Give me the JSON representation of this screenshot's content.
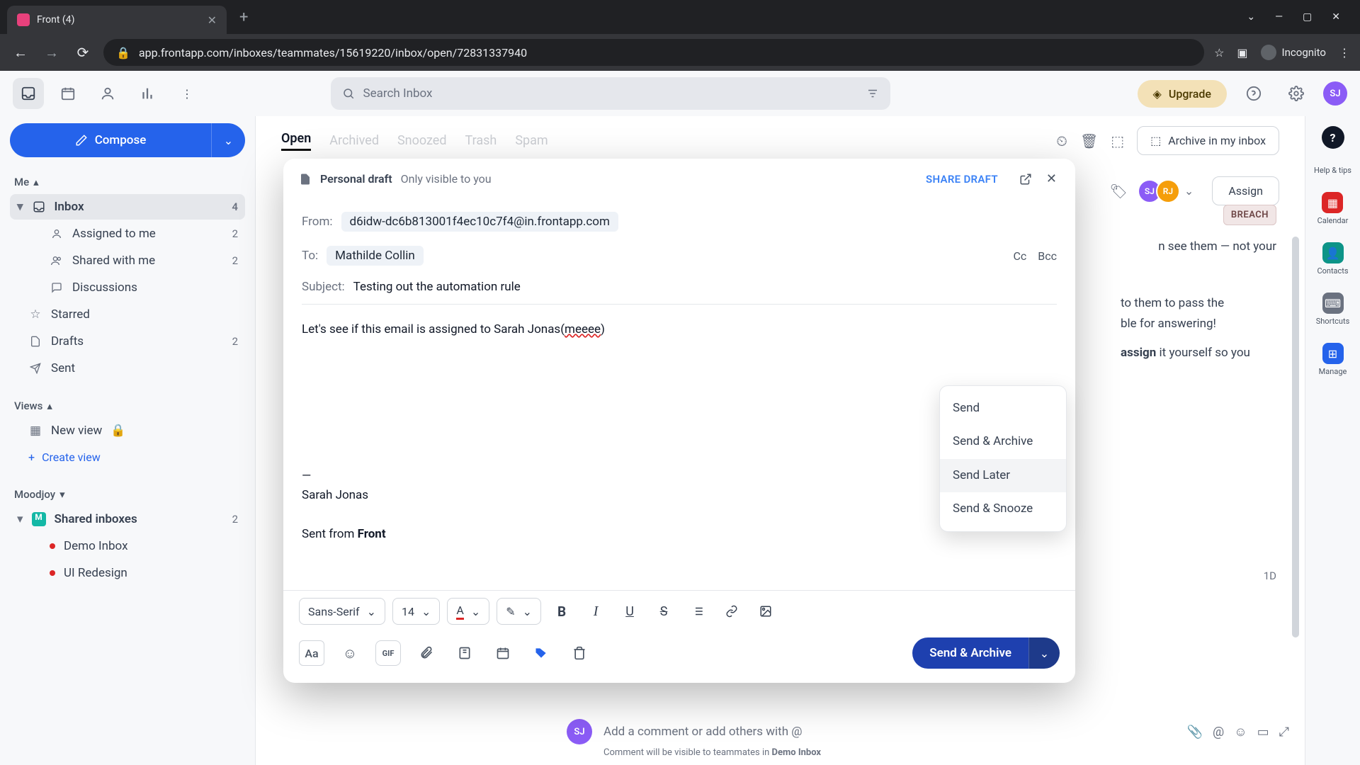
{
  "browser": {
    "tab_title": "Front (4)",
    "url_display": "app.frontapp.com/inboxes/teammates/15619220/inbox/open/72831337940",
    "incognito_label": "Incognito"
  },
  "header": {
    "search_placeholder": "Search Inbox",
    "upgrade_label": "Upgrade",
    "avatar_initials": "SJ"
  },
  "sidebar": {
    "compose_label": "Compose",
    "sections": {
      "me_label": "Me",
      "views_label": "Views",
      "moodjoy_label": "Moodjoy"
    },
    "items": {
      "inbox": {
        "label": "Inbox",
        "count": "4"
      },
      "assigned": {
        "label": "Assigned to me",
        "count": "2"
      },
      "shared": {
        "label": "Shared with me",
        "count": "2"
      },
      "discussions": {
        "label": "Discussions"
      },
      "starred": {
        "label": "Starred"
      },
      "drafts": {
        "label": "Drafts",
        "count": "2"
      },
      "sent": {
        "label": "Sent"
      },
      "new_view": {
        "label": "New view"
      },
      "create_view": {
        "label": "Create view"
      },
      "shared_inboxes": {
        "label": "Shared inboxes",
        "count": "2"
      },
      "demo_inbox": {
        "label": "Demo Inbox"
      },
      "ui_redesign": {
        "label": "UI Redesign"
      }
    }
  },
  "main": {
    "tabs": {
      "open": "Open",
      "archived": "Archived",
      "snoozed": "Snoozed",
      "trash": "Trash",
      "spam": "Spam"
    },
    "archive_label": "Archive in my inbox",
    "assign_label": "Assign",
    "breach_tag": "BREACH",
    "assignee_a": "SJ",
    "assignee_b": "RJ",
    "bg_text_1a": " to them to pass the",
    "bg_text_1b": "ble for answering!",
    "bg_text_2a": "assign",
    "bg_text_2b": " it yourself so you",
    "bg_text_0a": "n see them — not your",
    "timestamp": "1D"
  },
  "compose": {
    "badge": "Personal draft",
    "badge_sub": "Only visible to you",
    "share_label": "SHARE DRAFT",
    "from_label": "From:",
    "from_value": "d6idw-dc6b813001f4ec10c7f4@in.frontapp.com",
    "to_label": "To:",
    "to_value": "Mathilde Collin",
    "cc_label": "Cc",
    "bcc_label": "Bcc",
    "subject_label": "Subject:",
    "subject_value": "Testing out the automation rule",
    "body_pre": "Let's see if this email is assigned to Sarah Jonas(",
    "body_typo": "meeee",
    "body_post": ")",
    "sig_divider": "—",
    "sig_name": "Sarah Jonas",
    "sig_sent_pre": "Sent from ",
    "sig_sent_strong": "Front",
    "format": {
      "font": "Sans-Serif",
      "size": "14"
    },
    "send_button": "Send & Archive",
    "send_menu": {
      "send": "Send",
      "send_archive": "Send & Archive",
      "send_later": "Send Later",
      "send_snooze": "Send & Snooze"
    }
  },
  "rail": {
    "help_tips": "Help & tips",
    "calendar": "Calendar",
    "contacts": "Contacts",
    "shortcuts": "Shortcuts",
    "manage": "Manage"
  },
  "comment": {
    "avatar": "SJ",
    "placeholder": "Add a comment or add others with @",
    "sub_pre": "Comment will be visible to teammates in ",
    "sub_strong": "Demo Inbox"
  }
}
